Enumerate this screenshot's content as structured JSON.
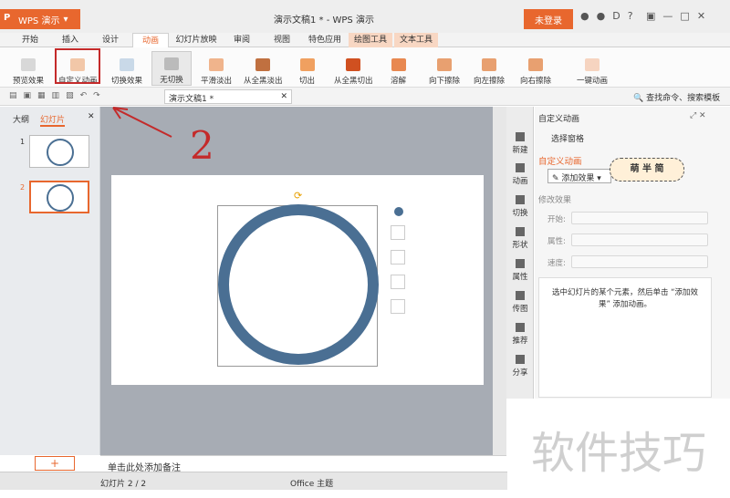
{
  "app": {
    "name": "WPS 演示",
    "doc_title": "演示文稿1 * - WPS 演示",
    "login": "未登录"
  },
  "tabs": [
    "开始",
    "插入",
    "设计",
    "动画",
    "幻灯片放映",
    "审阅",
    "视图",
    "特色应用",
    "绘图工具",
    "文本工具"
  ],
  "ribbon": {
    "items": [
      "预览效果",
      "自定义动画",
      "切换效果",
      "无切换",
      "平滑淡出",
      "从全黑淡出",
      "切出",
      "从全黑切出",
      "溶解",
      "向下擦除",
      "向左擦除",
      "向右擦除",
      "一键动画"
    ]
  },
  "qat": {
    "doc_tab": "演示文稿1 *",
    "search": "查找命令、搜索模板"
  },
  "left": {
    "tab_outline": "大纲",
    "tab_slides": "幻灯片",
    "slide_nums": [
      "1",
      "2"
    ],
    "add": "+"
  },
  "annotation": {
    "text": "2"
  },
  "notes": "单击此处添加备注",
  "status": {
    "slide": "幻灯片 2 / 2",
    "theme": "Office 主题"
  },
  "sidebar": [
    "新建",
    "动画",
    "切换",
    "形状",
    "属性",
    "传图",
    "推荐",
    "分享"
  ],
  "pane": {
    "title": "自定义动画",
    "select_pane": "选择窗格",
    "section": "自定义动画",
    "add_effect": "添加效果",
    "sticker": "萌 半 简",
    "modify": "修改效果",
    "start": "开始:",
    "prop": "属性:",
    "speed": "速度:",
    "hint": "选中幻灯片的某个元素，然后单击 “添加效果” 添加动画。"
  },
  "watermark": "软件技巧",
  "colors": {
    "accent": "#e8672e",
    "circle": "#4a6f93",
    "red": "#c42a2a"
  }
}
